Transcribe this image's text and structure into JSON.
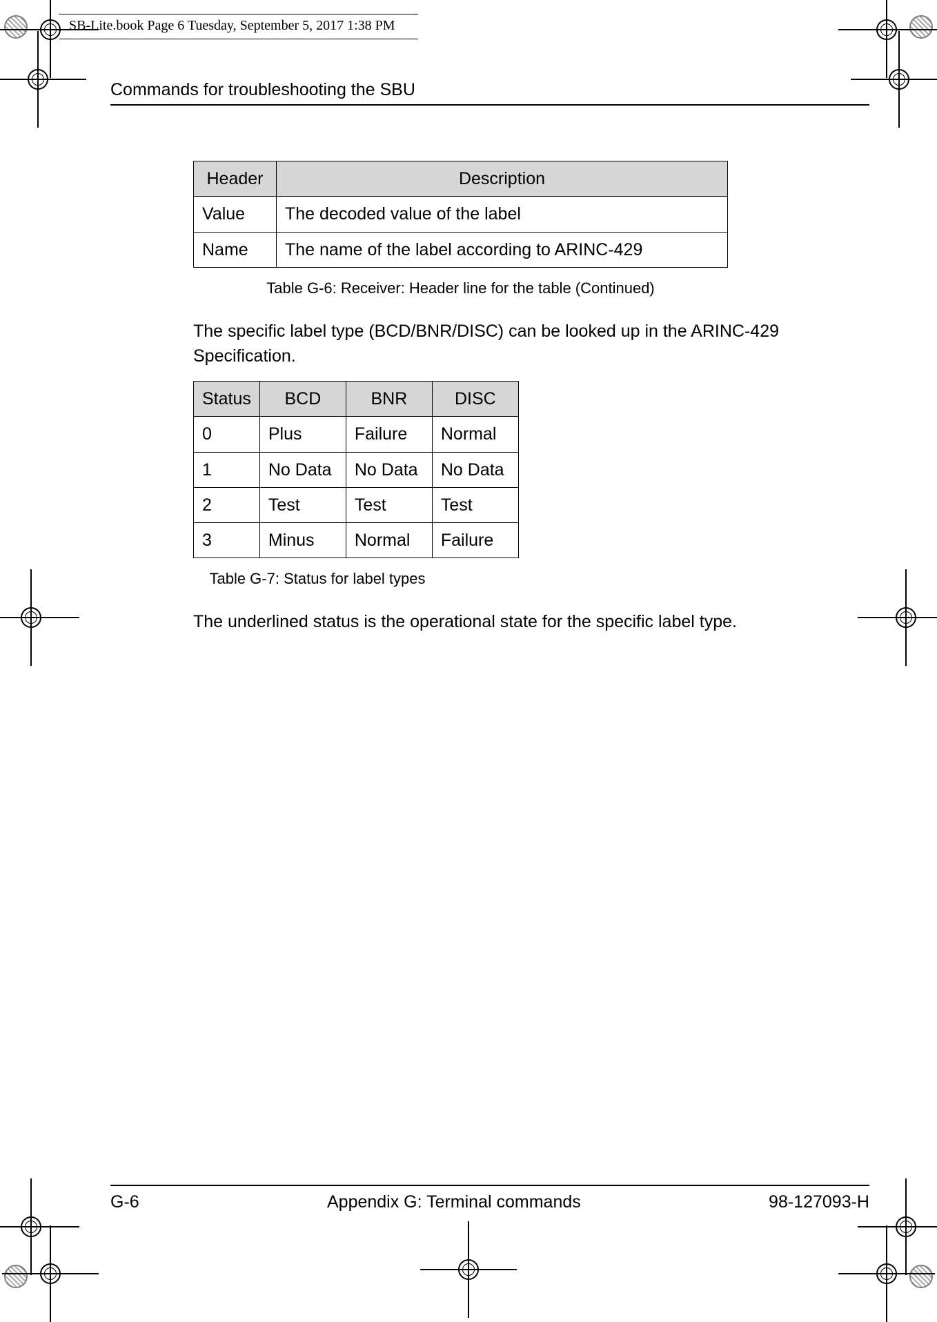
{
  "running_head": "SB-Lite.book  Page 6  Tuesday, September 5, 2017  1:38 PM",
  "section_title": "Commands for troubleshooting the SBU",
  "table_g6": {
    "caption": "Table G-6: Receiver: Header line for the table  (Continued)",
    "head": {
      "c1": "Header",
      "c2": "Description"
    },
    "rows": [
      {
        "c1": "Value",
        "c2": "The decoded value of the label"
      },
      {
        "c1": "Name",
        "c2": "The name of the label according to ARINC-429"
      }
    ]
  },
  "para1": "The specific label type (BCD/BNR/DISC) can be looked up in the ARINC-429 Specification.",
  "table_g7": {
    "caption": "Table G-7: Status for label types",
    "head": {
      "c1": "Status",
      "c2": "BCD",
      "c3": "BNR",
      "c4": "DISC"
    },
    "rows": [
      {
        "c1": "0",
        "c2": "Plus",
        "c3": "Failure",
        "c4": "Normal"
      },
      {
        "c1": "1",
        "c2": "No Data",
        "c3": "No Data",
        "c4": "No Data"
      },
      {
        "c1": "2",
        "c2": "Test",
        "c3": "Test",
        "c4": "Test"
      },
      {
        "c1": "3",
        "c2": "Minus",
        "c3": "Normal",
        "c4": "Failure"
      }
    ]
  },
  "para2": "The underlined status is the operational state for the specific label type.",
  "footer": {
    "page_no": "G-6",
    "center": "Appendix G:  Terminal commands",
    "doc_no": "98-127093-H"
  }
}
